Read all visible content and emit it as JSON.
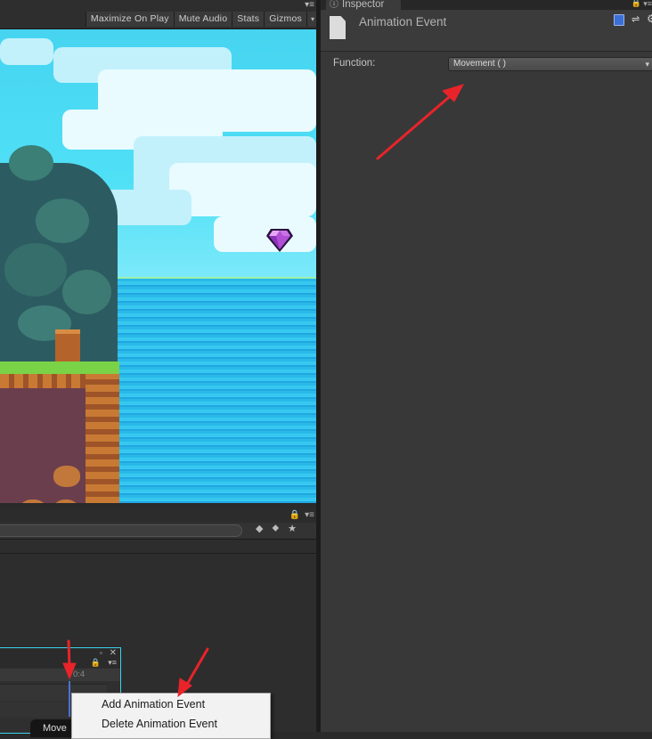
{
  "game_view": {
    "toolbar": {
      "maximize_label": "Maximize On Play",
      "mute_label": "Mute Audio",
      "stats_label": "Stats",
      "gizmos_label": "Gizmos"
    }
  },
  "animation": {
    "time_label": "0:4"
  },
  "context_menu": {
    "items": [
      "Add Animation Event",
      "Delete Animation Event"
    ]
  },
  "tooltip": {
    "text": "Move"
  },
  "inspector": {
    "tab_label": "Inspector",
    "title": "Animation Event",
    "function_label": "Function:",
    "function_value": "Movement ( )"
  },
  "colors": {
    "annotation_arrow": "#e8242a",
    "accent_outline": "#3ad4ee",
    "playhead": "#4b73d6"
  }
}
